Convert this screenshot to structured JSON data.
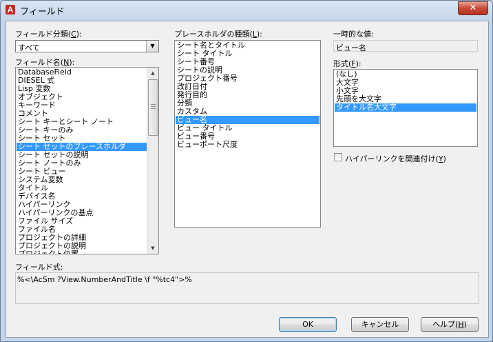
{
  "window": {
    "title": "フィールド",
    "app_icon": "A",
    "close_glyph": "✕"
  },
  "field_category": {
    "label_pre": "フィールド分類(",
    "label_key": "C",
    "label_post": "):",
    "selected": "すべて"
  },
  "field_names": {
    "label_pre": "フィールド名(",
    "label_key": "N",
    "label_post": "):",
    "items": [
      "DatabaseField",
      "DIESEL 式",
      "Lisp 変数",
      "オブジェクト",
      "キーワード",
      "コメント",
      "シート キーとシート ノート",
      "シート キーのみ",
      "シート セット",
      "シート セットのプレースホルダ",
      "シート セットの説明",
      "シート ノートのみ",
      "シート ビュー",
      "システム変数",
      "タイトル",
      "デバイス名",
      "ハイパーリンク",
      "ハイパーリンクの基点",
      "ファイル サイズ",
      "ファイル名",
      "プロジェクトの詳細",
      "プロジェクトの説明",
      "プロジェクト位置"
    ],
    "selected_index": 9
  },
  "placeholder_types": {
    "label_pre": "プレースホルダの種類(",
    "label_key": "L",
    "label_post": "):",
    "items": [
      "シート名とタイトル",
      "シート タイトル",
      "シート番号",
      "シートの説明",
      "プロジェクト番号",
      "改訂日付",
      "発行目的",
      "分類",
      "カスタム",
      "ビュー名",
      "ビュー タイトル",
      "ビュー番号",
      "ビューポート尺度"
    ],
    "selected_index": 9
  },
  "temp_value": {
    "label": "一時的な値:",
    "value": "ビュー名"
  },
  "format": {
    "label_pre": "形式(",
    "label_key": "F",
    "label_post": "):",
    "items": [
      "(なし)",
      "大文字",
      "小文字",
      "先頭を大文字",
      "タイトル名大文字"
    ],
    "selected_index": 4
  },
  "hyperlink": {
    "label_pre": "ハイパーリンクを関連付け(",
    "label_key": "Y",
    "label_post": ")",
    "checked": false
  },
  "expression": {
    "label": "フィールド式:",
    "value": "%<\\AcSm ?View.NumberAndTitle \\f \"%tc4\">%"
  },
  "buttons": {
    "ok": "OK",
    "cancel": "キャンセル",
    "help_pre": "ヘルプ(",
    "help_key": "H",
    "help_post": ")"
  },
  "colors": {
    "selection": "#3399ff",
    "dialog_bg": "#f0f0f0",
    "close": "#c74a36"
  }
}
